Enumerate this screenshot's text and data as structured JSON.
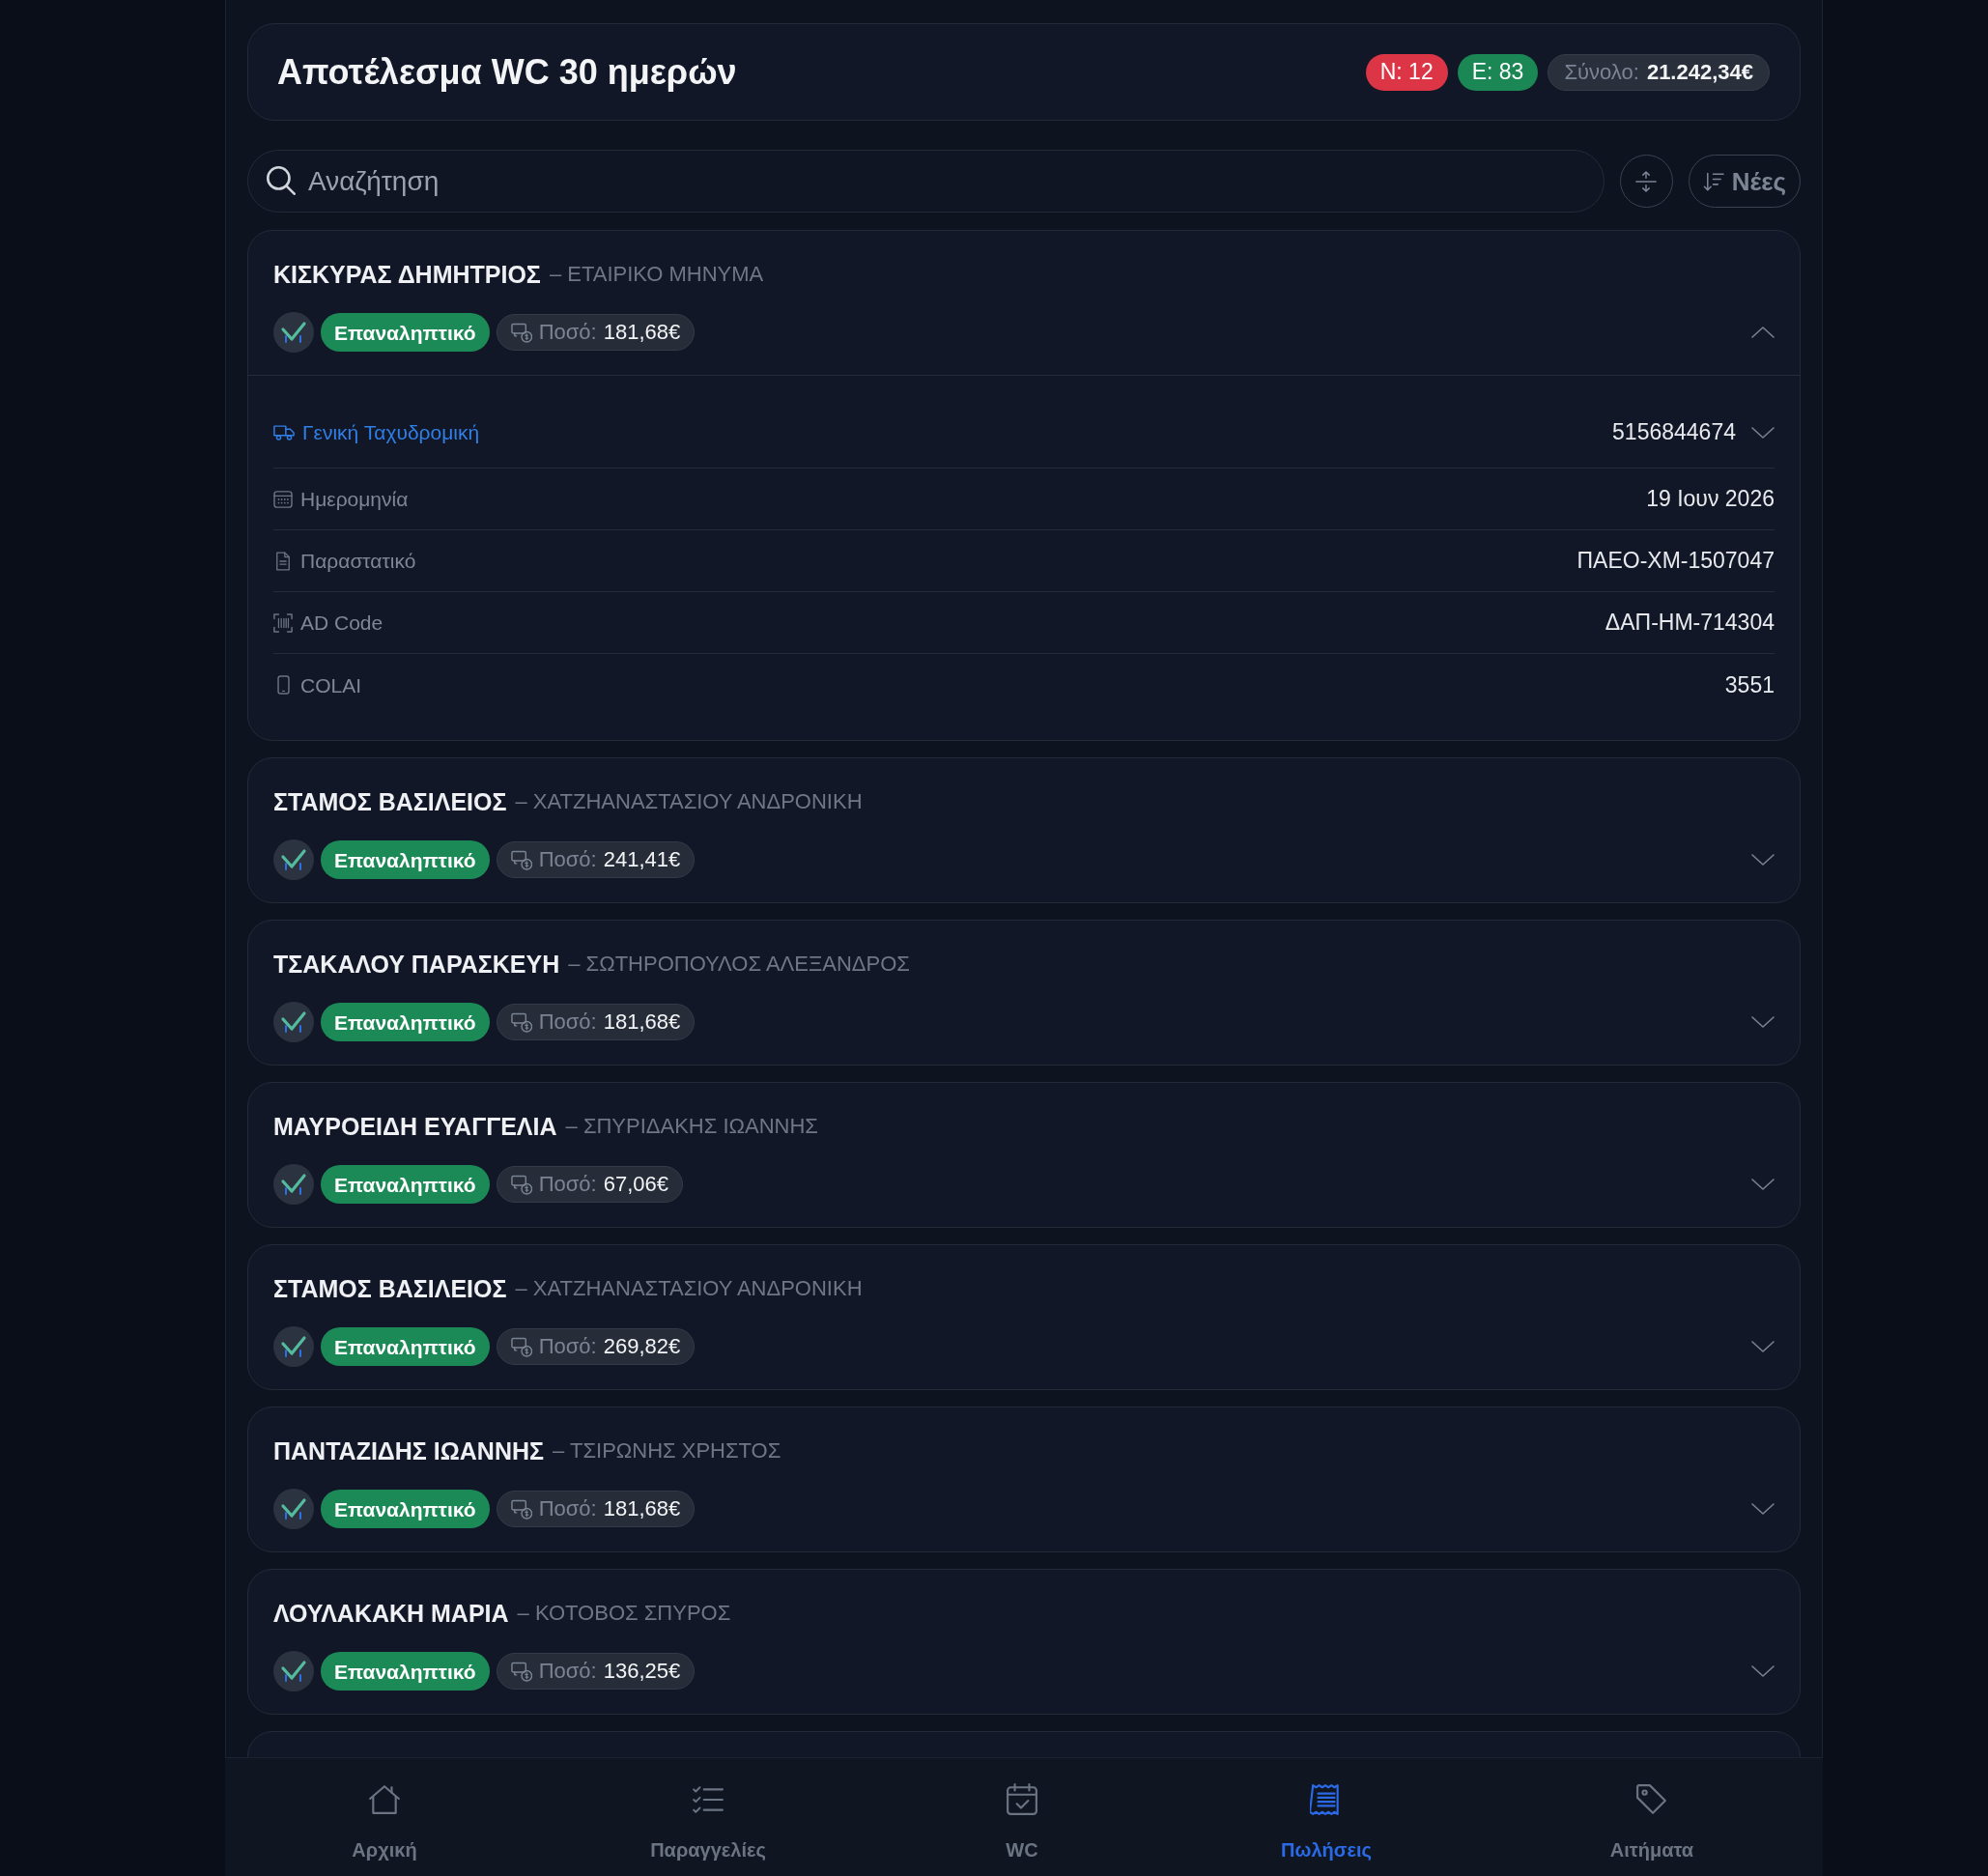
{
  "header": {
    "title": "Αποτέλεσμα WC 30 ημερών",
    "counts": [
      {
        "text": "N: 12",
        "color": "#dc3545"
      },
      {
        "text": "E: 83",
        "color": "#1a8754"
      }
    ],
    "total": {
      "label": "Σύνολο:",
      "value": "21.242,34€"
    }
  },
  "toolbar": {
    "search": {
      "placeholder": "Αναζήτηση"
    },
    "sort": {
      "label": "Νέες"
    }
  },
  "orders": [
    {
      "name": "ΚΙΣΚΥΡΑΣ ΔΗΜΗΤΡΙΟΣ",
      "subtitle": "– ΕΤΑΙΡΙΚΟ ΜΗΝΥΜΑ",
      "tag": "Επαναληπτικό",
      "amount_label": "Ποσό:",
      "amount": "181,68€",
      "expanded": true,
      "details": [
        {
          "kind": "courier",
          "label": "Γενική Ταχυδρομική",
          "value": "5156844674",
          "expanded": false
        },
        {
          "kind": "date",
          "label": "Ημερομηνία",
          "value": "19 Ιουν 2026"
        },
        {
          "kind": "document",
          "label": "Παραστατικό",
          "value": "ΠΑΕΟ-ΧΜ-1507047"
        },
        {
          "kind": "code",
          "label": "AD Code",
          "value": "ΔΑΠ-ΗΜ-714304"
        },
        {
          "kind": "device",
          "label": "COLAI",
          "value": "3551"
        }
      ]
    },
    {
      "name": "ΣΤΑΜΟΣ ΒΑΣΙΛΕΙΟΣ",
      "subtitle": "– ΧΑΤΖΗΑΝΑΣΤΑΣΙΟΥ ΑΝΔΡΟΝΙΚΗ",
      "tag": "Επαναληπτικό",
      "amount_label": "Ποσό:",
      "amount": "241,41€",
      "expanded": false
    },
    {
      "name": "ΤΣΑΚΑΛΟΥ ΠΑΡΑΣΚΕΥΗ",
      "subtitle": "– ΣΩΤΗΡΟΠΟΥΛΟΣ ΑΛΕΞΑΝΔΡΟΣ",
      "tag": "Επαναληπτικό",
      "amount_label": "Ποσό:",
      "amount": "181,68€",
      "expanded": false
    },
    {
      "name": "ΜΑΥΡΟΕΙΔΗ ΕΥΑΓΓΕΛΙΑ",
      "subtitle": "– ΣΠΥΡΙΔΑΚΗΣ ΙΩΑΝΝΗΣ",
      "tag": "Επαναληπτικό",
      "amount_label": "Ποσό:",
      "amount": "67,06€",
      "expanded": false
    },
    {
      "name": "ΣΤΑΜΟΣ ΒΑΣΙΛΕΙΟΣ",
      "subtitle": "– ΧΑΤΖΗΑΝΑΣΤΑΣΙΟΥ ΑΝΔΡΟΝΙΚΗ",
      "tag": "Επαναληπτικό",
      "amount_label": "Ποσό:",
      "amount": "269,82€",
      "expanded": false
    },
    {
      "name": "ΠΑΝΤΑΖΙΔΗΣ ΙΩΑΝΝΗΣ",
      "subtitle": "– ΤΣΙΡΩΝΗΣ ΧΡΗΣΤΟΣ",
      "tag": "Επαναληπτικό",
      "amount_label": "Ποσό:",
      "amount": "181,68€",
      "expanded": false
    },
    {
      "name": "ΛΟΥΛΑΚΑΚΗ ΜΑΡΙΑ",
      "subtitle": "– ΚΟΤΟΒΟΣ ΣΠΥΡΟΣ",
      "tag": "Επαναληπτικό",
      "amount_label": "Ποσό:",
      "amount": "136,25€",
      "expanded": false
    }
  ],
  "nav": [
    {
      "label": "Αρχική",
      "selected": false
    },
    {
      "label": "Παραγγελίες",
      "selected": false
    },
    {
      "label": "WC",
      "selected": false
    },
    {
      "label": "Πωλήσεις",
      "selected": true
    },
    {
      "label": "Αιτήματα",
      "selected": false
    }
  ]
}
